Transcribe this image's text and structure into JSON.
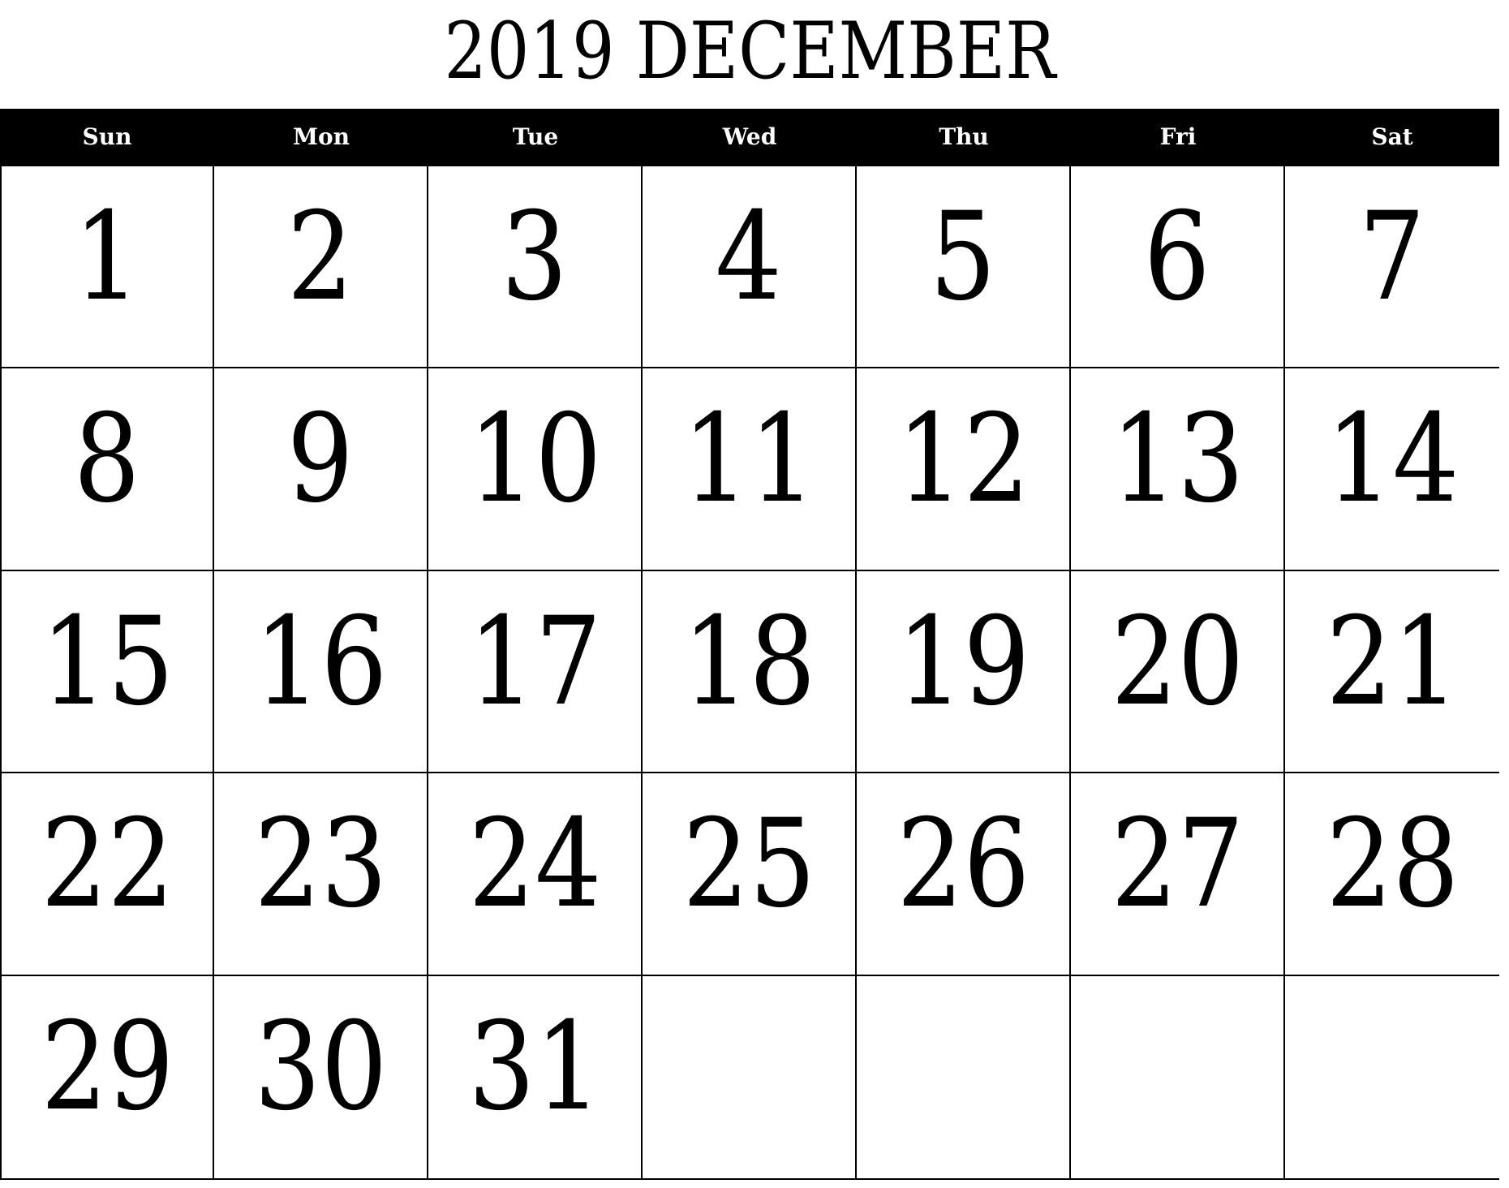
{
  "title": "2019 DECEMBER",
  "year": 2019,
  "month": "DECEMBER",
  "weekdays": [
    "Sun",
    "Mon",
    "Tue",
    "Wed",
    "Thu",
    "Fri",
    "Sat"
  ],
  "weeks": [
    [
      "1",
      "2",
      "3",
      "4",
      "5",
      "6",
      "7"
    ],
    [
      "8",
      "9",
      "10",
      "11",
      "12",
      "13",
      "14"
    ],
    [
      "15",
      "16",
      "17",
      "18",
      "19",
      "20",
      "21"
    ],
    [
      "22",
      "23",
      "24",
      "25",
      "26",
      "27",
      "28"
    ],
    [
      "29",
      "30",
      "31",
      "",
      "",
      "",
      ""
    ]
  ],
  "colors": {
    "header_background": "#000000",
    "header_text": "#ffffff",
    "grid_lines": "#000000",
    "day_text": "#000000",
    "page_background": "#ffffff"
  }
}
